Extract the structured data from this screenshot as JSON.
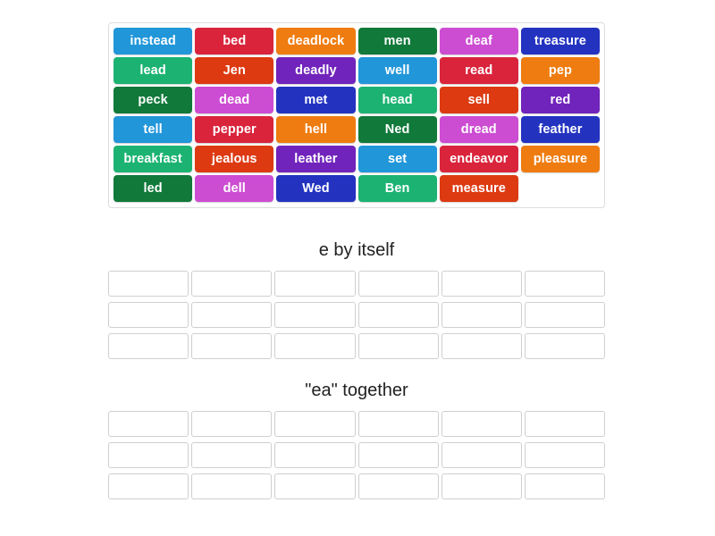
{
  "activity": {
    "type": "group-sort",
    "tile_text_color": "#ffffff",
    "slot_border_color": "#cfcfcf",
    "pool_border_color": "#dcdcdc"
  },
  "palette": {
    "sky_blue": "#2196d9",
    "crimson": "#d9243c",
    "orange": "#ef7c10",
    "forest_green": "#11793a",
    "orchid": "#cc4cd2",
    "royal_blue": "#2333c0",
    "emerald": "#1cb372",
    "orange_red": "#dd3a12",
    "purple": "#7124bb"
  },
  "tile_pool": {
    "rows": [
      [
        {
          "label": "instead",
          "color": "#2196d9"
        },
        {
          "label": "bed",
          "color": "#d9243c"
        },
        {
          "label": "deadlock",
          "color": "#ef7c10"
        },
        {
          "label": "men",
          "color": "#11793a"
        },
        {
          "label": "deaf",
          "color": "#cc4cd2"
        },
        {
          "label": "treasure",
          "color": "#2333c0"
        }
      ],
      [
        {
          "label": "lead",
          "color": "#1cb372"
        },
        {
          "label": "Jen",
          "color": "#dd3a12"
        },
        {
          "label": "deadly",
          "color": "#7124bb"
        },
        {
          "label": "well",
          "color": "#2196d9"
        },
        {
          "label": "read",
          "color": "#d9243c"
        },
        {
          "label": "pep",
          "color": "#ef7c10"
        }
      ],
      [
        {
          "label": "peck",
          "color": "#11793a"
        },
        {
          "label": "dead",
          "color": "#cc4cd2"
        },
        {
          "label": "met",
          "color": "#2333c0"
        },
        {
          "label": "head",
          "color": "#1cb372"
        },
        {
          "label": "sell",
          "color": "#dd3a12"
        },
        {
          "label": "red",
          "color": "#7124bb"
        }
      ],
      [
        {
          "label": "tell",
          "color": "#2196d9"
        },
        {
          "label": "pepper",
          "color": "#d9243c"
        },
        {
          "label": "hell",
          "color": "#ef7c10"
        },
        {
          "label": "Ned",
          "color": "#11793a"
        },
        {
          "label": "dread",
          "color": "#cc4cd2"
        },
        {
          "label": "feather",
          "color": "#2333c0"
        }
      ],
      [
        {
          "label": "breakfast",
          "color": "#1cb372"
        },
        {
          "label": "jealous",
          "color": "#dd3a12"
        },
        {
          "label": "leather",
          "color": "#7124bb"
        },
        {
          "label": "set",
          "color": "#2196d9"
        },
        {
          "label": "endeavor",
          "color": "#d9243c"
        },
        {
          "label": "pleasure",
          "color": "#ef7c10"
        }
      ],
      [
        {
          "label": "led",
          "color": "#11793a"
        },
        {
          "label": "dell",
          "color": "#cc4cd2"
        },
        {
          "label": "Wed",
          "color": "#2333c0"
        },
        {
          "label": "Ben",
          "color": "#1cb372"
        },
        {
          "label": "measure",
          "color": "#dd3a12"
        },
        {
          "label": "",
          "color": "",
          "empty": true
        }
      ]
    ]
  },
  "groups": [
    {
      "title": "e by itself",
      "slot_rows": 3,
      "slots_per_row": 6
    },
    {
      "title": "\"ea\" together",
      "slot_rows": 3,
      "slots_per_row": 6
    }
  ]
}
